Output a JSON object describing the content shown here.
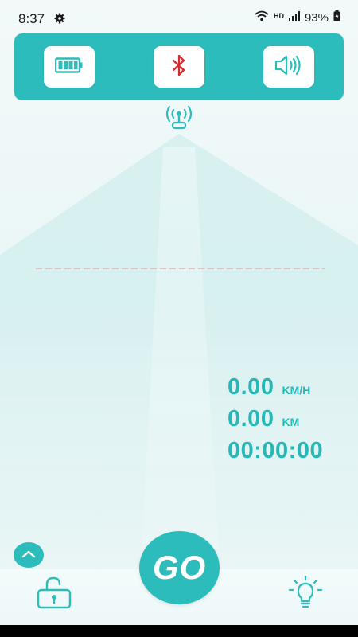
{
  "status_bar": {
    "time": "8:37",
    "network_label": "HD",
    "battery_percent": "93%"
  },
  "top_panel": {
    "buttons": [
      {
        "icon": "battery-icon"
      },
      {
        "icon": "bluetooth-icon"
      },
      {
        "icon": "speaker-icon"
      }
    ]
  },
  "stats": {
    "speed_value": "0.00",
    "speed_unit": "KM/H",
    "distance_value": "0.00",
    "distance_unit": "KM",
    "elapsed_time": "00:00:00"
  },
  "controls": {
    "go_label": "GO",
    "collapse_icon": "chevron-up-icon",
    "lock_icon": "unlock-icon",
    "light_icon": "light-bulb-icon"
  },
  "colors": {
    "accent": "#2cbcbc",
    "bluetooth_red": "#d82a2a",
    "dashed_line": "#e88a8a"
  }
}
